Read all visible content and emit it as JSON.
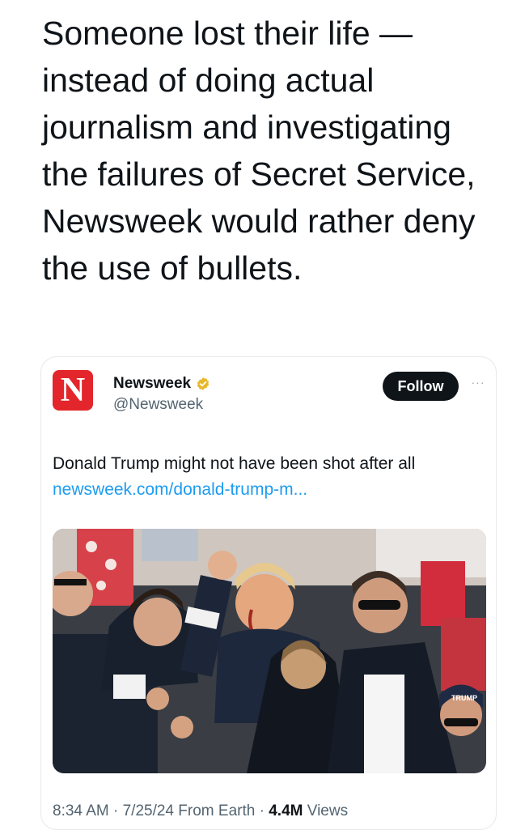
{
  "post": {
    "text": "Someone lost their life — instead of doing actual journalism and investigating the failures of Secret Service, Newsweek would rather deny the use of bullets."
  },
  "quoted": {
    "logo_letter": "N",
    "account_name": "Newsweek",
    "handle": "@Newsweek",
    "follow_label": "Follow",
    "more_label": "···",
    "text": "Donald Trump might not have been shot after all",
    "link": "newsweek.com/donald-trump-m...",
    "time": "8:34 AM",
    "sep1": " · ",
    "date": "7/25/24",
    "source": " From Earth",
    "sep2": " · ",
    "views_count": "4.4M",
    "views_label": " Views",
    "photo_alt": "Photo of Donald Trump with raised fist surrounded by Secret Service agents",
    "cap_text": "TRUMP"
  },
  "colors": {
    "brand_red": "#e2262b",
    "link_blue": "#1d9bf0",
    "verified_gold": "#e8b829"
  },
  "icons": {
    "verified": "verified-badge-icon",
    "more": "more-options-icon"
  }
}
